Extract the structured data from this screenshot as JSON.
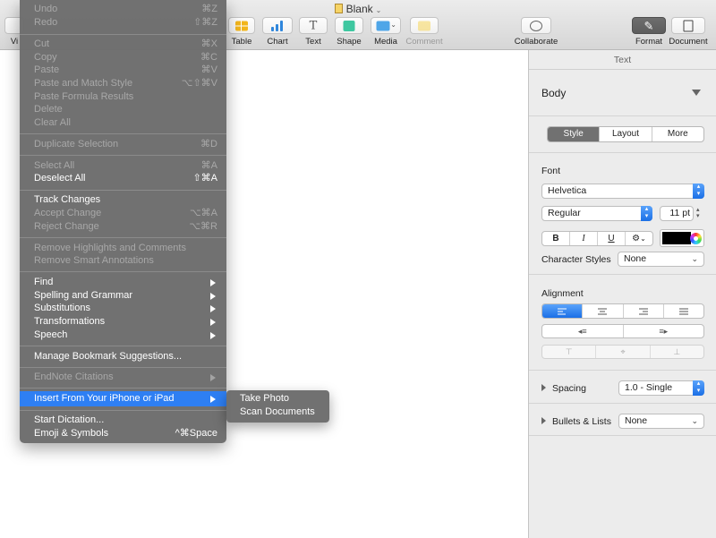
{
  "window": {
    "title": "Blank"
  },
  "toolbar": {
    "view_label": "Vi",
    "table_label": "Table",
    "chart_label": "Chart",
    "text_label": "Text",
    "shape_label": "Shape",
    "media_label": "Media",
    "comment_label": "Comment",
    "collaborate_label": "Collaborate",
    "format_label": "Format",
    "document_label": "Document"
  },
  "edit_menu": {
    "undo": {
      "label": "Undo",
      "shortcut": "⌘Z"
    },
    "redo": {
      "label": "Redo",
      "shortcut": "⇧⌘Z"
    },
    "cut": {
      "label": "Cut",
      "shortcut": "⌘X"
    },
    "copy": {
      "label": "Copy",
      "shortcut": "⌘C"
    },
    "paste": {
      "label": "Paste",
      "shortcut": "⌘V"
    },
    "paste_match": {
      "label": "Paste and Match Style",
      "shortcut": "⌥⇧⌘V"
    },
    "paste_formula": {
      "label": "Paste Formula Results"
    },
    "delete": {
      "label": "Delete"
    },
    "clear_all": {
      "label": "Clear All"
    },
    "duplicate": {
      "label": "Duplicate Selection",
      "shortcut": "⌘D"
    },
    "select_all": {
      "label": "Select All",
      "shortcut": "⌘A"
    },
    "deselect_all": {
      "label": "Deselect All",
      "shortcut": "⇧⌘A"
    },
    "track_changes": {
      "label": "Track Changes"
    },
    "accept_change": {
      "label": "Accept Change",
      "shortcut": "⌥⌘A"
    },
    "reject_change": {
      "label": "Reject Change",
      "shortcut": "⌥⌘R"
    },
    "remove_highlights": {
      "label": "Remove Highlights and Comments"
    },
    "remove_smart": {
      "label": "Remove Smart Annotations"
    },
    "find": {
      "label": "Find"
    },
    "spelling": {
      "label": "Spelling and Grammar"
    },
    "substitutions": {
      "label": "Substitutions"
    },
    "transformations": {
      "label": "Transformations"
    },
    "speech": {
      "label": "Speech"
    },
    "bookmark": {
      "label": "Manage Bookmark Suggestions..."
    },
    "endnote": {
      "label": "EndNote Citations"
    },
    "insert_iphone": {
      "label": "Insert From Your iPhone or iPad"
    },
    "dictation": {
      "label": "Start Dictation..."
    },
    "emoji": {
      "label": "Emoji & Symbols",
      "shortcut": "^⌘Space"
    }
  },
  "submenu": {
    "take_photo": "Take Photo",
    "scan_documents": "Scan Documents"
  },
  "inspector": {
    "tab_label": "Text",
    "paragraph_style": "Body",
    "segments": {
      "style": "Style",
      "layout": "Layout",
      "more": "More",
      "selected": "Style"
    },
    "font": {
      "section": "Font",
      "family": "Helvetica",
      "typeface": "Regular",
      "size": "11 pt",
      "bold": "B",
      "italic": "I",
      "underline": "U",
      "gear": "⚙",
      "color": "#000000"
    },
    "character_styles": {
      "label": "Character Styles",
      "value": "None"
    },
    "alignment": {
      "section": "Alignment",
      "selected": "left"
    },
    "spacing": {
      "label": "Spacing",
      "value": "1.0 - Single"
    },
    "bullets": {
      "label": "Bullets & Lists",
      "value": "None"
    }
  },
  "colors": {
    "accent": "#2e7ff3",
    "menu_bg": "#6c6c6c"
  }
}
